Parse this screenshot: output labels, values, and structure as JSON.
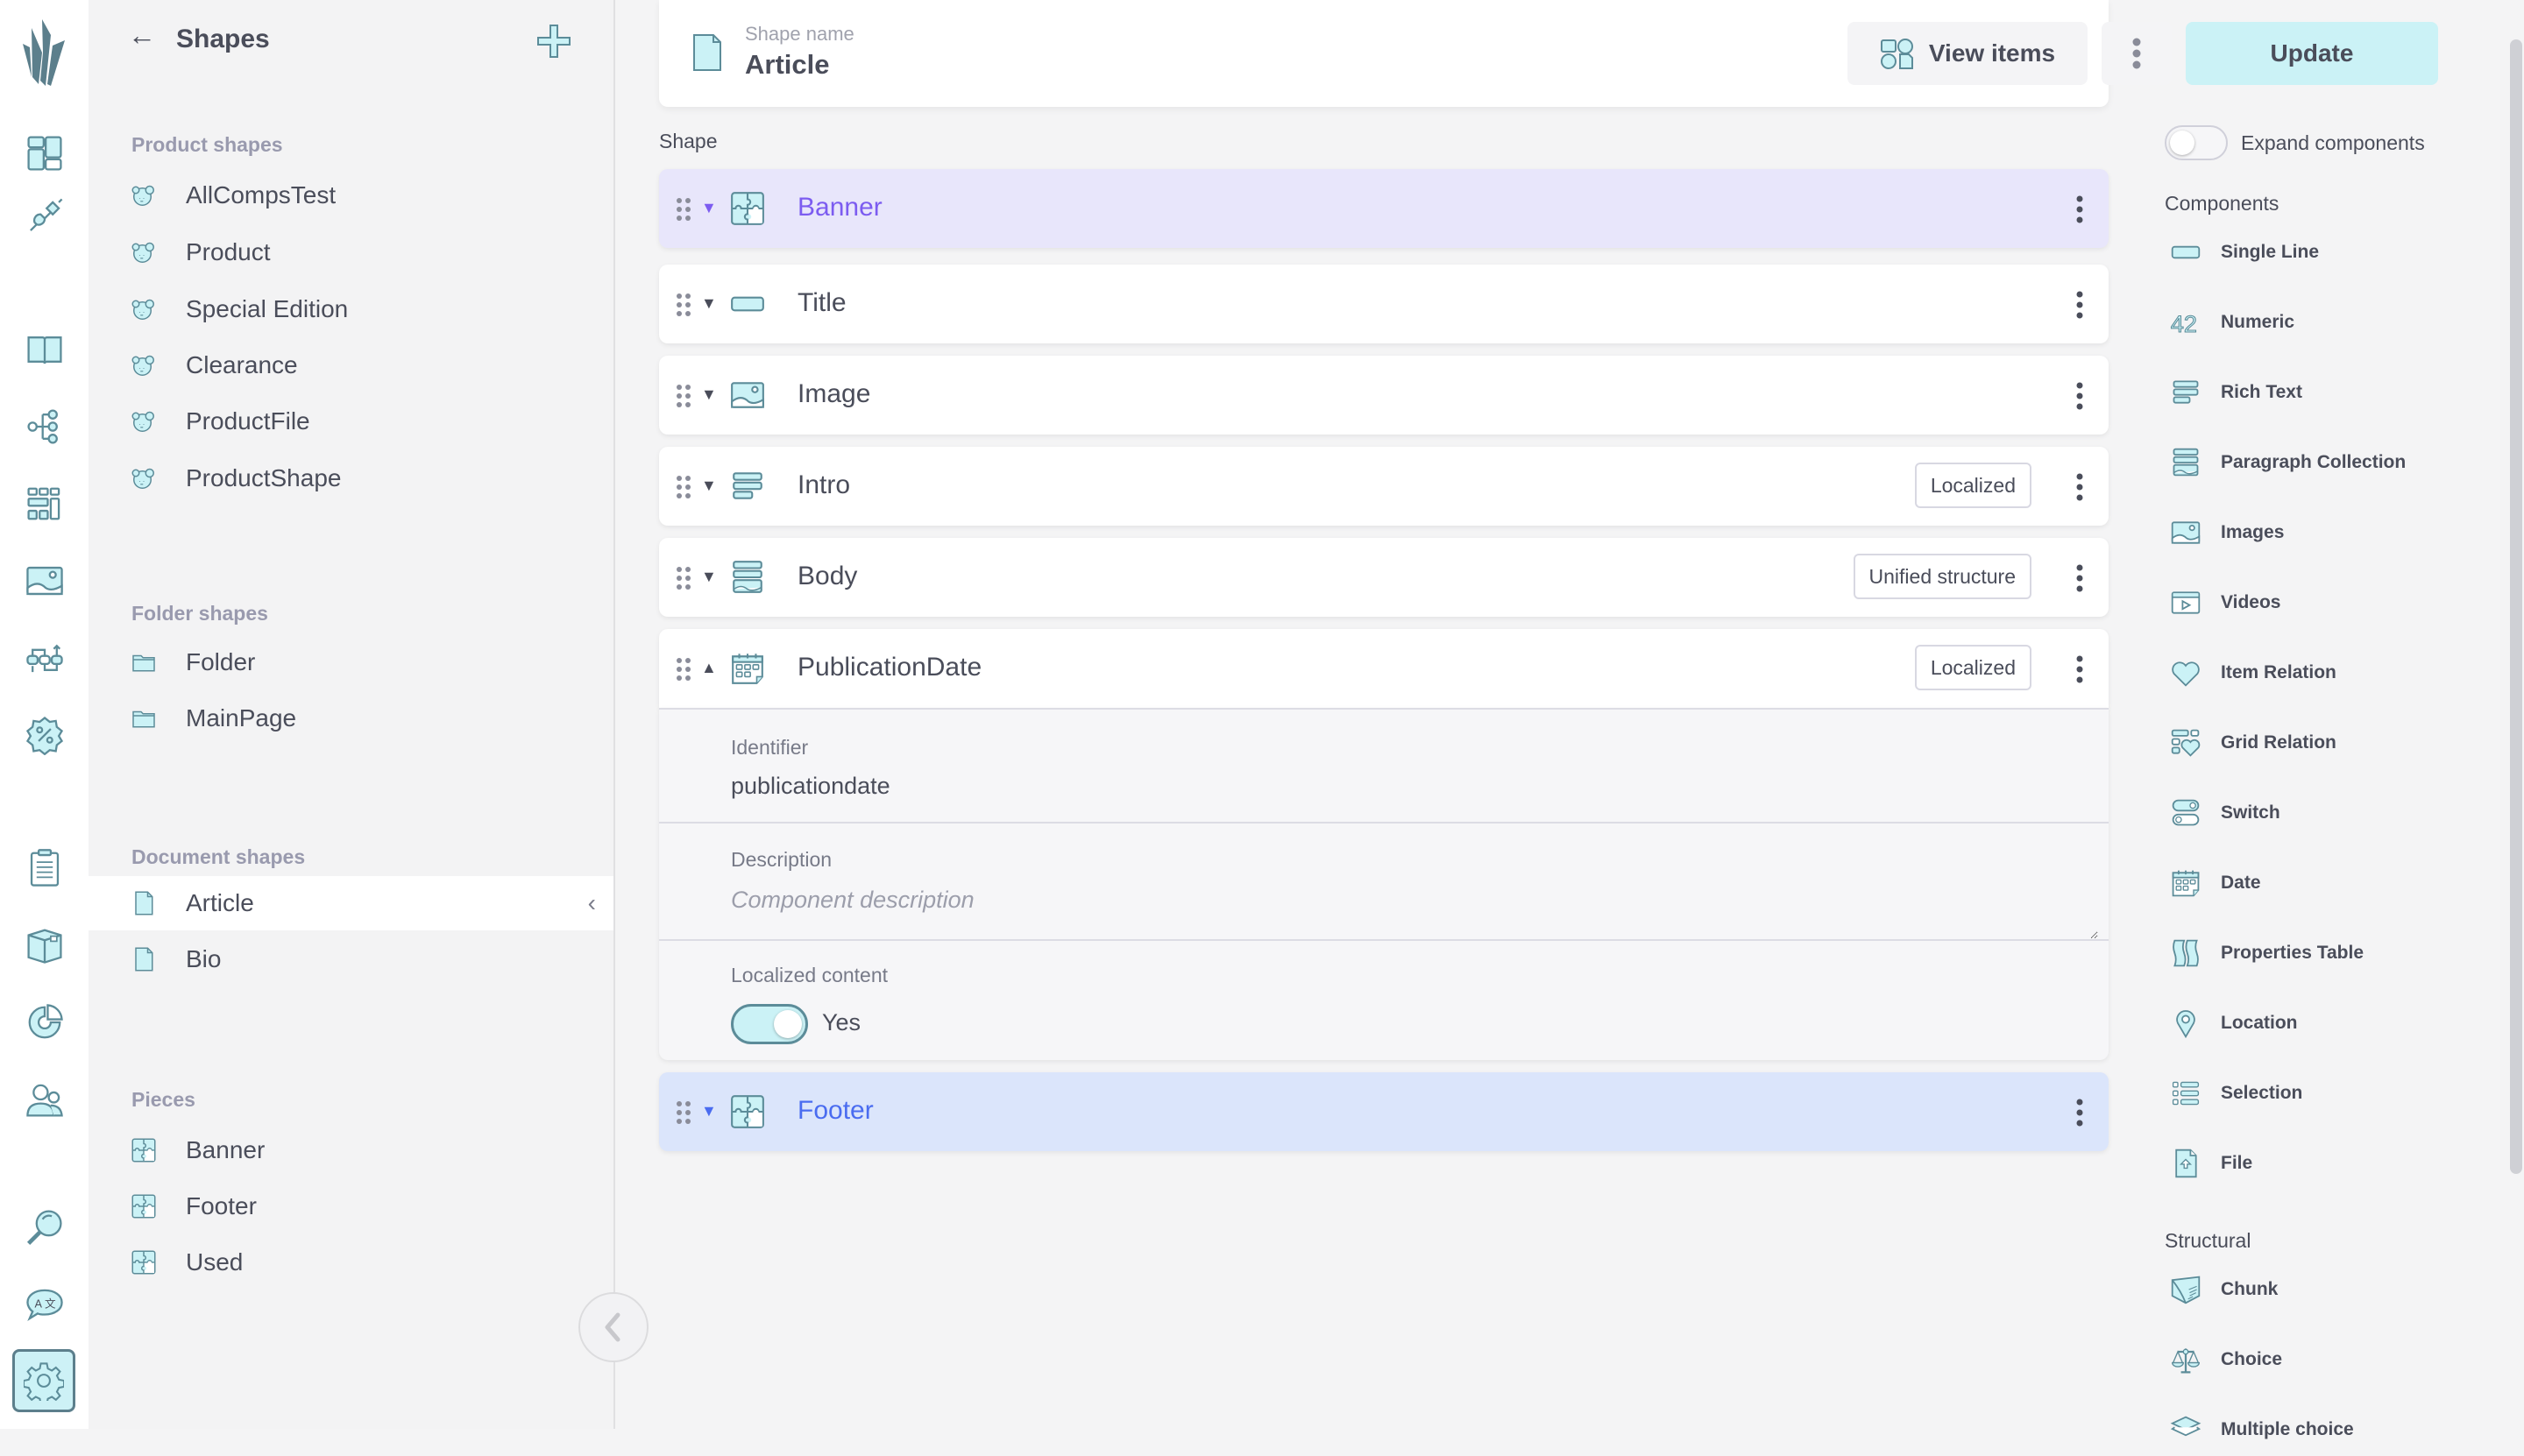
{
  "left_panel": {
    "title": "Shapes",
    "back_icon": "arrow-left-icon",
    "add_icon": "plus-icon",
    "sections": [
      {
        "label": "Product shapes",
        "icon": "product-shape-icon",
        "items": [
          "AllCompsTest",
          "Product",
          "Special Edition",
          "Clearance",
          "ProductFile",
          "ProductShape"
        ]
      },
      {
        "label": "Folder shapes",
        "icon": "folder-icon",
        "items": [
          "Folder",
          "MainPage"
        ]
      },
      {
        "label": "Document shapes",
        "icon": "document-icon",
        "items": [
          "Article",
          "Bio"
        ],
        "selected": "Article"
      },
      {
        "label": "Pieces",
        "icon": "puzzle-icon",
        "items": [
          "Banner",
          "Footer",
          "Used"
        ]
      }
    ]
  },
  "icon_rail": [
    "dashboard-icon",
    "plug-icon",
    "catalogue-book-icon",
    "topics-tree-icon",
    "grid-icon",
    "image-icon",
    "flows-icon",
    "discount-icon",
    "orders-clipboard-icon",
    "fulfilment-box-icon",
    "analytics-pie-icon",
    "customers-icon",
    "search-icon",
    "translate-icon",
    "settings-gear-icon"
  ],
  "header": {
    "shape_name_label": "Shape name",
    "shape_name": "Article",
    "view_items_label": "View items",
    "update_label": "Update"
  },
  "main": {
    "section_label": "Shape",
    "components": [
      {
        "name": "Banner",
        "type": "piece",
        "icon": "puzzle-icon",
        "badge": null,
        "expanded": false
      },
      {
        "name": "Title",
        "type": "singleLine",
        "icon": "single-line-icon",
        "badge": null,
        "expanded": false
      },
      {
        "name": "Image",
        "type": "images",
        "icon": "image-icon",
        "badge": null,
        "expanded": false
      },
      {
        "name": "Intro",
        "type": "richText",
        "icon": "rich-text-icon",
        "badge": "Localized",
        "expanded": false
      },
      {
        "name": "Body",
        "type": "paragraphCollection",
        "icon": "paragraph-collection-icon",
        "badge": "Unified structure",
        "expanded": false
      },
      {
        "name": "PublicationDate",
        "type": "date",
        "icon": "date-icon",
        "badge": "Localized",
        "expanded": true
      },
      {
        "name": "Footer",
        "type": "piece",
        "icon": "puzzle-icon",
        "badge": null,
        "expanded": false
      }
    ],
    "detail": {
      "identifier_label": "Identifier",
      "identifier_value": "publicationdate",
      "description_label": "Description",
      "description_placeholder": "Component description",
      "localized_label": "Localized content",
      "localized_value": "Yes",
      "localized_on": true
    }
  },
  "right_panel": {
    "expand_label": "Expand components",
    "expand_on": false,
    "components_label": "Components",
    "components": [
      {
        "label": "Single Line",
        "icon": "single-line-icon"
      },
      {
        "label": "Numeric",
        "icon": "numeric-icon"
      },
      {
        "label": "Rich Text",
        "icon": "rich-text-icon"
      },
      {
        "label": "Paragraph Collection",
        "icon": "paragraph-collection-icon"
      },
      {
        "label": "Images",
        "icon": "image-icon"
      },
      {
        "label": "Videos",
        "icon": "video-icon"
      },
      {
        "label": "Item Relation",
        "icon": "heart-icon"
      },
      {
        "label": "Grid Relation",
        "icon": "grid-relation-icon"
      },
      {
        "label": "Switch",
        "icon": "switch-icon"
      },
      {
        "label": "Date",
        "icon": "date-icon"
      },
      {
        "label": "Properties Table",
        "icon": "properties-table-icon"
      },
      {
        "label": "Location",
        "icon": "location-pin-icon"
      },
      {
        "label": "Selection",
        "icon": "selection-list-icon"
      },
      {
        "label": "File",
        "icon": "file-upload-icon"
      }
    ],
    "structural_label": "Structural",
    "structural": [
      {
        "label": "Chunk",
        "icon": "chunk-icon"
      },
      {
        "label": "Choice",
        "icon": "choice-scale-icon"
      },
      {
        "label": "Multiple choice",
        "icon": "layers-icon"
      }
    ]
  },
  "colors": {
    "accent_fill": "#cbf2f6",
    "icon_stroke": "#5c8c99",
    "banner_bg": "#e8e6fb",
    "banner_text": "#7c5cf0",
    "footer_bg": "#dbe5fb",
    "footer_text": "#4a6cf0",
    "text": "#4a4d5a"
  }
}
